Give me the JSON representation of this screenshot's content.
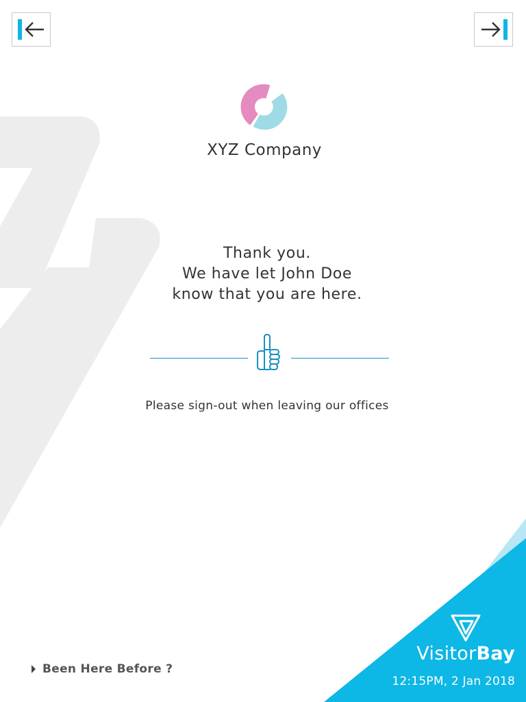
{
  "nav": {
    "back_icon": "arrow-left-bar-icon",
    "forward_icon": "arrow-right-bar-icon"
  },
  "company": {
    "logo_icon": "ring-logo-icon",
    "name": "XYZ Company"
  },
  "message": {
    "line1": "Thank you.",
    "line2": "We have let John Doe",
    "line3": "know that you are here."
  },
  "confirmation": {
    "icon": "thumbs-up-icon"
  },
  "signout_note": "Please sign-out when leaving our offices",
  "footer": {
    "been_here_label": "Been Here Before ?",
    "brand_light": "Visitor",
    "brand_bold": "Bay",
    "datetime": "12:15PM, 2 Jan 2018"
  },
  "colors": {
    "accent_blue": "#0db7e6",
    "accent_light_blue": "#b8e6f4",
    "logo_pink": "#e48bc0",
    "logo_cyan": "#9fdbe6",
    "divider_blue": "#1a8fc2",
    "watermark_gray": "#ededed"
  }
}
